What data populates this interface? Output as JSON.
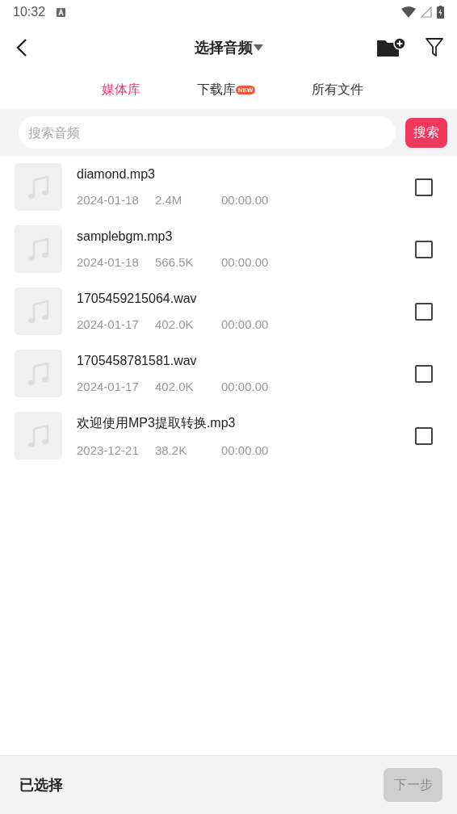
{
  "status_bar": {
    "time": "10:32"
  },
  "header": {
    "title": "选择音频"
  },
  "tabs": [
    {
      "label": "媒体库",
      "selected": true
    },
    {
      "label": "下载库",
      "selected": false,
      "badge": "NEW"
    },
    {
      "label": "所有文件",
      "selected": false
    }
  ],
  "search": {
    "placeholder": "搜索音频",
    "button": "搜索"
  },
  "files": [
    {
      "name": "diamond.mp3",
      "date": "2024-01-18",
      "size": "2.4M",
      "duration": "00:00.00",
      "checked": false
    },
    {
      "name": "samplebgm.mp3",
      "date": "2024-01-18",
      "size": "566.5K",
      "duration": "00:00.00",
      "checked": false
    },
    {
      "name": "1705459215064.wav",
      "date": "2024-01-17",
      "size": "402.0K",
      "duration": "00:00.00",
      "checked": false
    },
    {
      "name": "1705458781581.wav",
      "date": "2024-01-17",
      "size": "402.0K",
      "duration": "00:00.00",
      "checked": false
    },
    {
      "name": "欢迎使用MP3提取转换.mp3",
      "date": "2023-12-21",
      "size": "38.2K",
      "duration": "00:00.00",
      "checked": false
    }
  ],
  "footer": {
    "label": "已选择",
    "next_button": {
      "label": "下一步",
      "disabled": true
    }
  }
}
